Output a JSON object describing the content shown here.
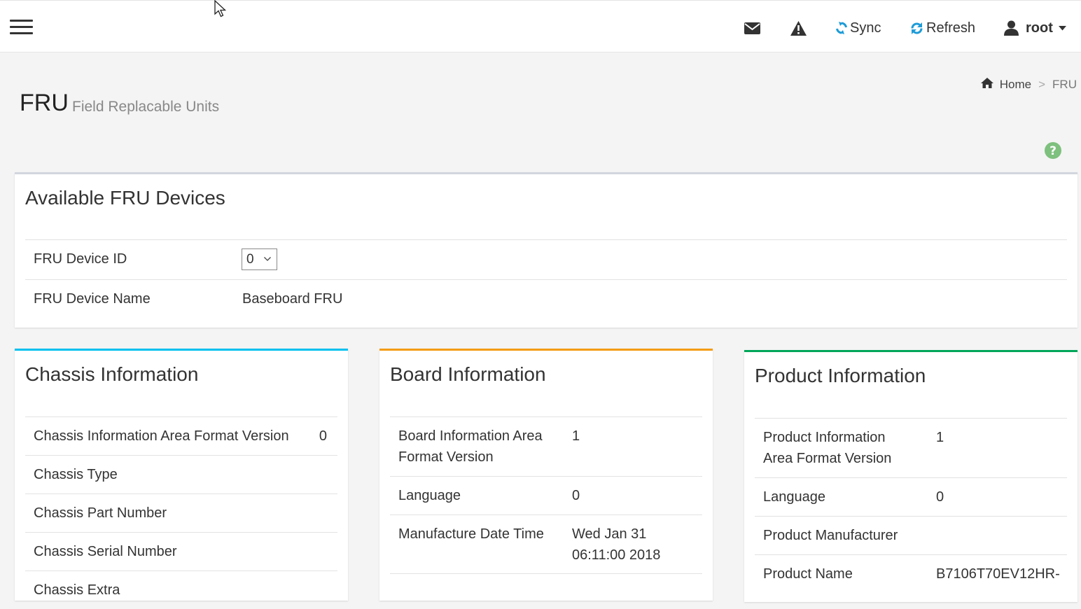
{
  "topbar": {
    "sync_label": "Sync",
    "refresh_label": "Refresh",
    "user_name": "root"
  },
  "colors": {
    "sync": "#1e9bd7",
    "refresh": "#1e9bd7",
    "help": "#7ec07e",
    "chassis_accent": "#00c0ef",
    "board_accent": "#f39c12",
    "product_accent": "#00a65a"
  },
  "page": {
    "title": "FRU",
    "subtitle": "Field Replacable Units"
  },
  "breadcrumb": {
    "home": "Home",
    "separator": ">",
    "current": "FRU"
  },
  "fru_devices": {
    "title": "Available FRU Devices",
    "device_id_label": "FRU Device ID",
    "device_id_value": "0",
    "device_name_label": "FRU Device Name",
    "device_name_value": "Baseboard FRU"
  },
  "chassis": {
    "title": "Chassis Information",
    "rows": [
      {
        "label": "Chassis Information Area Format Version",
        "value": "0"
      },
      {
        "label": "Chassis Type",
        "value": ""
      },
      {
        "label": "Chassis Part Number",
        "value": ""
      },
      {
        "label": "Chassis Serial Number",
        "value": ""
      },
      {
        "label": "Chassis Extra",
        "value": ""
      }
    ]
  },
  "board": {
    "title": "Board Information",
    "rows": [
      {
        "label_line1": "Board Information Area",
        "label_line2": "Format Version",
        "value": "1"
      },
      {
        "label": "Language",
        "value": "0"
      },
      {
        "label": "Manufacture Date Time",
        "value_line1": "Wed Jan 31",
        "value_line2": "06:11:00 2018"
      }
    ]
  },
  "product": {
    "title": "Product Information",
    "rows": [
      {
        "label_line1": "Product Information",
        "label_line2": "Area Format Version",
        "value": "1"
      },
      {
        "label": "Language",
        "value": "0"
      },
      {
        "label": "Product Manufacturer",
        "value": ""
      },
      {
        "label": "Product Name",
        "value": "B7106T70EV12HR-"
      }
    ]
  }
}
